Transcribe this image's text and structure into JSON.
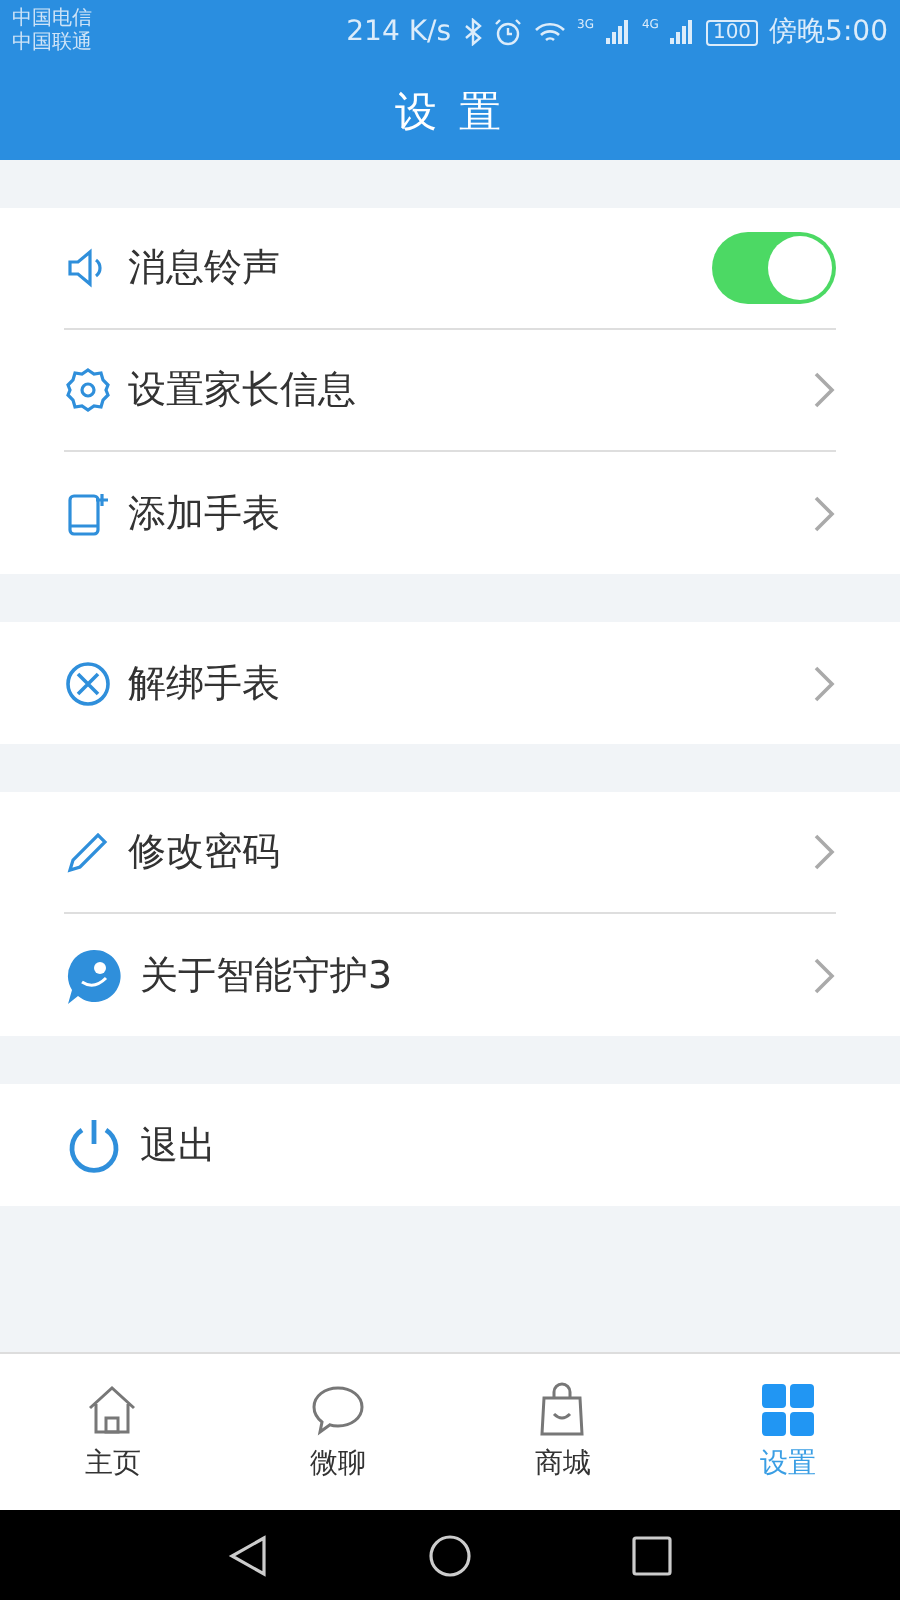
{
  "status_bar": {
    "carriers": [
      "中国电信",
      "中国联通"
    ],
    "speed": "214 K/s",
    "network_labels": [
      "3G",
      "4G"
    ],
    "battery": "100",
    "time": "傍晚5:00"
  },
  "header": {
    "title": "设 置"
  },
  "groups": [
    {
      "items": [
        {
          "label": "消息铃声",
          "kind": "toggle",
          "on": true
        },
        {
          "label": "设置家长信息",
          "kind": "link"
        },
        {
          "label": "添加手表",
          "kind": "link"
        }
      ]
    },
    {
      "items": [
        {
          "label": "解绑手表",
          "kind": "link"
        }
      ]
    },
    {
      "items": [
        {
          "label": "修改密码",
          "kind": "link"
        },
        {
          "label": "关于智能守护3",
          "kind": "link"
        }
      ]
    },
    {
      "items": [
        {
          "label": "退出",
          "kind": "plain"
        }
      ]
    }
  ],
  "tab_bar": [
    {
      "label": "主页",
      "selected": false
    },
    {
      "label": "微聊",
      "selected": false
    },
    {
      "label": "商城",
      "selected": false
    },
    {
      "label": "设置",
      "selected": true
    }
  ]
}
